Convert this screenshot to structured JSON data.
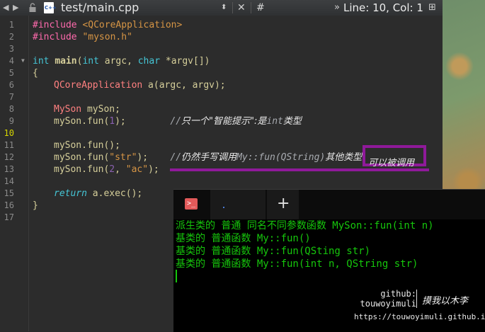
{
  "toolbar": {
    "back": "◀",
    "forward": "▶",
    "file_icon": "C++",
    "file_name": "test/main.cpp",
    "hash": "#",
    "line_col": "Line: 10, Col: 1",
    "updown": "⬍",
    "close": "✕",
    "more": "»",
    "split": "⊞"
  },
  "gutter": [
    "1",
    "2",
    "3",
    "4",
    "5",
    "6",
    "7",
    "8",
    "9",
    "10",
    "11",
    "12",
    "13",
    "14",
    "15",
    "16",
    "17"
  ],
  "code": {
    "l1_pp": "#include",
    "l1_inc": " <QCoreApplication>",
    "l2_pp": "#include",
    "l2_inc": " \"myson.h\"",
    "l4_kw1": "int",
    "l4_fn": "main",
    "l4_a": "(",
    "l4_kw2": "int",
    "l4_b": " argc, ",
    "l4_kw3": "char",
    "l4_c": " *argv[])",
    "l5": "{",
    "l6_ty": "QCoreApplication",
    "l6_rest": " a(argc, argv);",
    "l8_ty": "MySon",
    "l8_rest": " mySon;",
    "l9_a": "mySon.fun(",
    "l9_num": "1",
    "l9_b": ");        ",
    "l9_cmt": "//",
    "l9_zh": "只一个\"智能提示\":是",
    "l9_cmt2": "int",
    "l9_zh2": "类型",
    "l11": "mySon.fun();",
    "l12_a": "mySon.fun(",
    "l12_str": "\"str\"",
    "l12_b": ");    ",
    "l12_cmt": "//",
    "l12_zh": "仍然手写调用",
    "l12_cmt2": "My::fun(QString)",
    "l12_zh2": "其他类型",
    "l13_a": "mySon.fun(",
    "l13_num": "2",
    "l13_b": ", ",
    "l13_str": "\"ac\"",
    "l13_c": ");",
    "l15_ret": "return",
    "l15_rest": " a.exec();",
    "l16": "}",
    "callout": "可以被调用"
  },
  "terminal": {
    "tab_icon": ">_",
    "new_tab": "+",
    "lines": [
      "派生类的 普通 同名不同参数函数 MySon::fun(int n)",
      "基类的 普通函数 My::fun()",
      "基类的 普通函数 My::fun(QSting str)",
      "基类的 普通函数 My::fun(int n, QString str)"
    ]
  },
  "watermark": {
    "label1": "github:",
    "label2": "touwoyimuli",
    "signature": "摸我以木李",
    "url": "https://touwoyimuli.github.io"
  },
  "colors": {
    "accent_highlight": "#8f1a9a",
    "terminal_text": "#16c60c"
  }
}
